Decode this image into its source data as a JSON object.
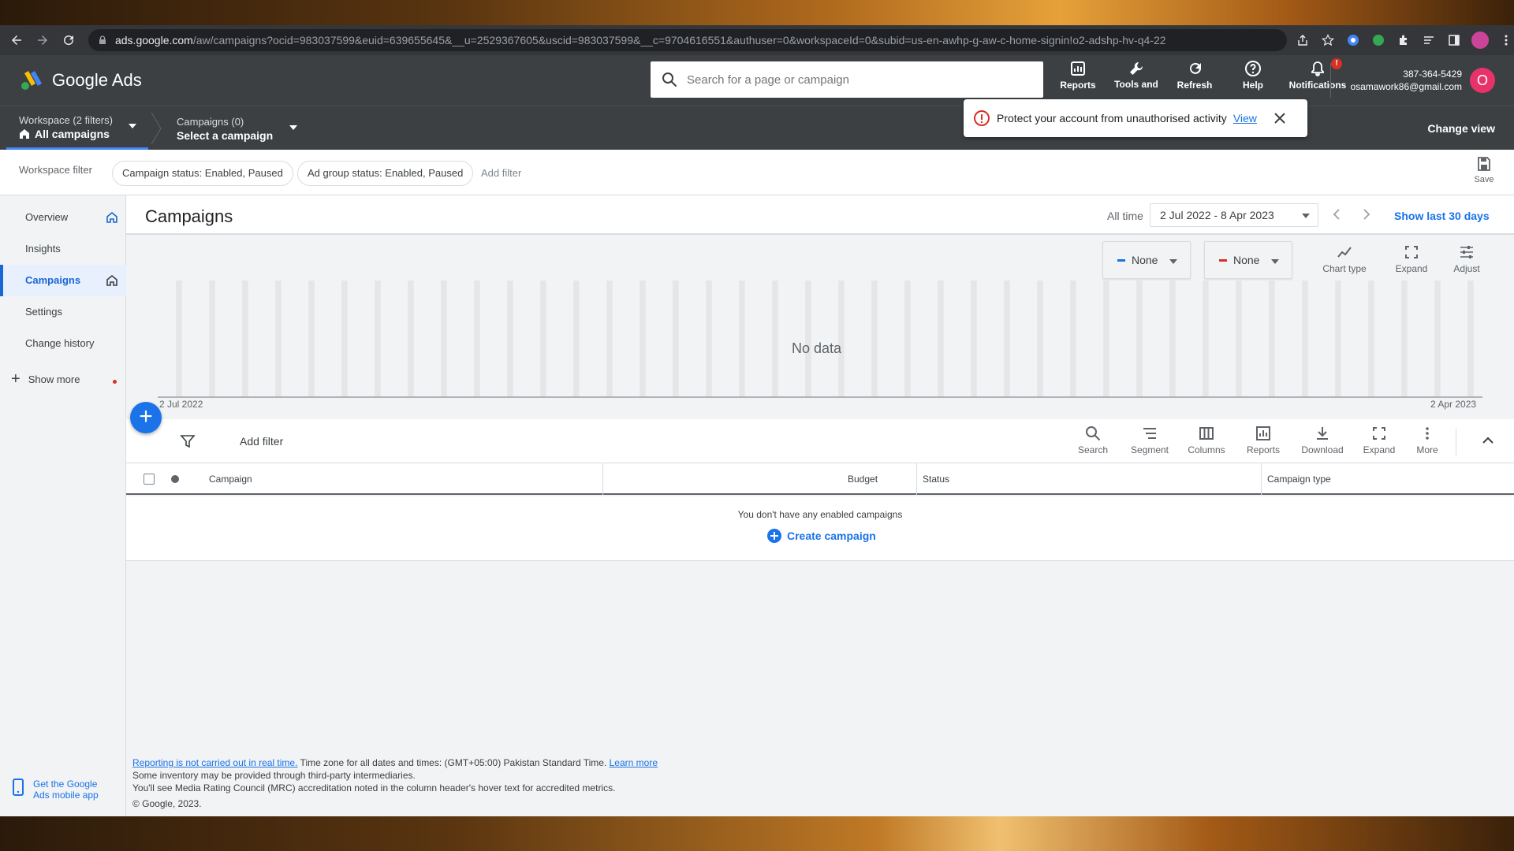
{
  "browser": {
    "url_host": "ads.google.com",
    "url_rest": "/aw/campaigns?ocid=983037599&euid=639655645&__u=2529367605&uscid=983037599&__c=9704616551&authuser=0&workspaceId=0&subid=us-en-awhp-g-aw-c-home-signin!o2-adshp-hv-q4-22"
  },
  "header": {
    "app_name": "Google Ads",
    "search_placeholder": "Search for a page or campaign",
    "tools": [
      {
        "label": "Reports",
        "icon": "reports-icon"
      },
      {
        "label": "Tools and settings",
        "icon": "wrench-icon"
      },
      {
        "label": "Refresh",
        "icon": "refresh-icon"
      },
      {
        "label": "Help",
        "icon": "help-icon"
      },
      {
        "label": "Notifications",
        "icon": "bell-icon",
        "badge": "!"
      }
    ],
    "account_id": "387-364-5429",
    "account_email": "osamawork86@gmail.com",
    "avatar_letter": "O"
  },
  "subheader": {
    "workspace_label": "Workspace (2 filters)",
    "workspace_value": "All campaigns",
    "campaigns_label": "Campaigns (0)",
    "campaigns_value": "Select a campaign",
    "change_view": "Change view"
  },
  "toast": {
    "message": "Protect your account from unauthorised activity",
    "link": "View"
  },
  "workspace_filter": {
    "label": "Workspace filter",
    "chips": [
      "Campaign status: Enabled, Paused",
      "Ad group status: Enabled, Paused"
    ],
    "add_filter": "Add filter",
    "save_label": "Save"
  },
  "sidebar": {
    "items": [
      {
        "label": "Overview",
        "active": false,
        "home": true
      },
      {
        "label": "Insights",
        "active": false,
        "home": false
      },
      {
        "label": "Campaigns",
        "active": true,
        "home": true
      },
      {
        "label": "Settings",
        "active": false,
        "home": false
      },
      {
        "label": "Change history",
        "active": false,
        "home": false
      }
    ],
    "show_more": "Show more",
    "mobile_app": [
      "Get the Google",
      "Ads mobile app"
    ]
  },
  "main": {
    "title": "Campaigns",
    "date_range_label": "All time",
    "date_range_value": "2 Jul 2022 - 8 Apr 2023",
    "show_last": "Show last 30 days"
  },
  "chart": {
    "metric1": "None",
    "metric1_color": "#1a73e8",
    "metric2": "None",
    "metric2_color": "#d93025",
    "tools": [
      "Chart type",
      "Expand",
      "Adjust"
    ],
    "no_data": "No data",
    "x_start": "2 Jul 2022",
    "x_end": "2 Apr 2023"
  },
  "table": {
    "add_filter": "Add filter",
    "tools": [
      "Search",
      "Segment",
      "Columns",
      "Reports",
      "Download",
      "Expand",
      "More"
    ],
    "columns": [
      "Campaign",
      "Budget",
      "Status",
      "Campaign type"
    ],
    "empty_message": "You don't have any enabled campaigns",
    "create_campaign": "Create campaign"
  },
  "footer": {
    "link1": "Reporting is not carried out in real time.",
    "text1": " Time zone for all dates and times: (GMT+05:00) Pakistan Standard Time. ",
    "link2": "Learn more",
    "line2": "Some inventory may be provided through third-party intermediaries.",
    "line3": "You'll see Media Rating Council (MRC) accreditation noted in the column header's hover text for accredited metrics.",
    "line4": "© Google, 2023."
  }
}
